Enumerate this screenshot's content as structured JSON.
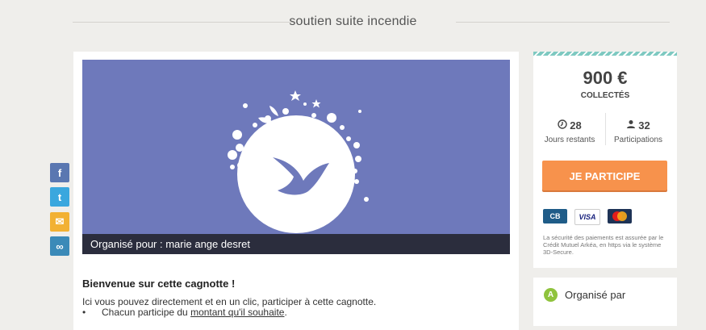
{
  "page": {
    "title": "soutien suite incendie"
  },
  "share": {
    "facebook": "f",
    "twitter": "t",
    "email": "✉",
    "link": "∞"
  },
  "banner": {
    "caption": "Organisé pour : marie ange desret"
  },
  "content": {
    "welcome": "Bienvenue sur cette cagnotte !",
    "intro": "Ici vous pouvez directement et en un clic, participer à cette cagnotte.",
    "bullet1_prefix": "Chacun participe du ",
    "bullet1_link": "montant qu'il souhaite",
    "bullet1_suffix": "."
  },
  "summary": {
    "amount": "900 €",
    "amount_label": "COLLECTÉS",
    "days_value": "28",
    "days_label": "Jours restants",
    "participants_value": "32",
    "participants_label": "Participations",
    "cta_label": "JE PARTICIPE",
    "payment_cards": [
      "CB",
      "VISA",
      "MasterCard"
    ],
    "security_text": "La sécurité des paiements est assurée par le Crédit Mutuel Arkéa, en https via le système 3D-Secure."
  },
  "organizer": {
    "label": "Organisé par"
  },
  "colors": {
    "banner": "#6e79bb",
    "cta": "#f7924c",
    "stripe": "#7ec9c1"
  }
}
